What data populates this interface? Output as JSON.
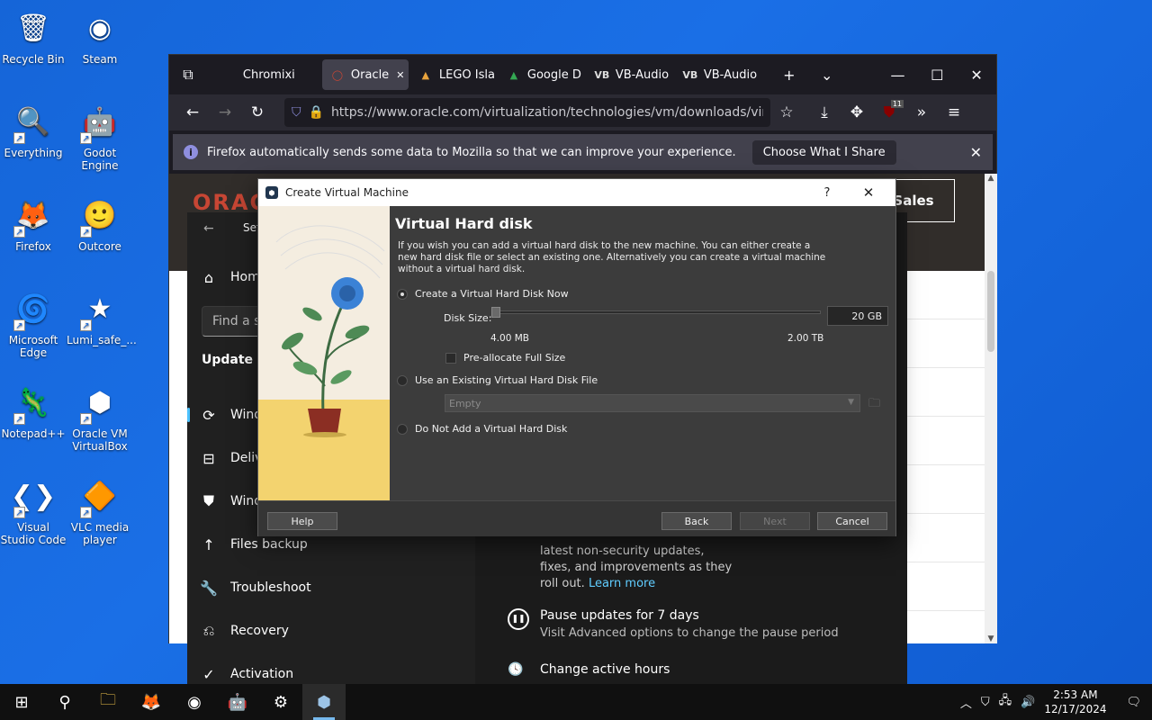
{
  "desktop": {
    "icons": [
      {
        "label": "Recycle Bin",
        "icon": "recycle-bin-icon",
        "glyph": "🗑"
      },
      {
        "label": "Steam",
        "icon": "steam-icon",
        "glyph": "◉"
      },
      {
        "label": "Everything",
        "icon": "everything-search-icon",
        "glyph": "🔍"
      },
      {
        "label": "Godot Engine",
        "icon": "godot-icon",
        "glyph": "🤖"
      },
      {
        "label": "Firefox",
        "icon": "firefox-icon",
        "glyph": "🦊"
      },
      {
        "label": "Outcore",
        "icon": "outcore-icon",
        "glyph": "🙂"
      },
      {
        "label": "Microsoft Edge",
        "icon": "edge-icon",
        "glyph": "🌀"
      },
      {
        "label": "Lumi_safe_...",
        "icon": "star-icon",
        "glyph": "★"
      },
      {
        "label": "Notepad++",
        "icon": "notepad-plus-plus-icon",
        "glyph": "🦎"
      },
      {
        "label": "Oracle VM VirtualBox",
        "icon": "virtualbox-icon",
        "glyph": "⬢"
      },
      {
        "label": "Visual Studio Code",
        "icon": "vscode-icon",
        "glyph": "❮❯"
      },
      {
        "label": "VLC media player",
        "icon": "vlc-icon",
        "glyph": "🔶"
      }
    ]
  },
  "firefox": {
    "tabs": [
      {
        "label": "Chromixi",
        "fav": ""
      },
      {
        "label": "Oracle",
        "fav": "◯"
      },
      {
        "label": "LEGO Isla",
        "fav": "▲"
      },
      {
        "label": "Google D",
        "fav": "▲"
      },
      {
        "label": "VB-Audio",
        "fav": "VB"
      },
      {
        "label": "VB-Audio",
        "fav": "VB"
      }
    ],
    "url": "https://www.oracle.com/virtualization/technologies/vm/downloads/virtualbox",
    "extension_badge": "11",
    "notice": {
      "text": "Firefox automatically sends some data to Mozilla so that we can improve your experience.",
      "button": "Choose What I Share"
    },
    "page": {
      "logo": "ORACLE",
      "sales_button": "t Sales"
    }
  },
  "settings": {
    "title": "Set",
    "nav": {
      "home": "Home",
      "search_placeholder": "Find a se",
      "section": "Update &",
      "items": [
        "Wind",
        "Deliv",
        "Wind",
        "Files backup",
        "Troubleshoot",
        "Recovery",
        "Activation"
      ]
    },
    "main": {
      "partial_text": "latest non-security updates, fixes, and improvements as they roll out.",
      "learn_more": "Learn more",
      "pause_title": "Pause updates for 7 days",
      "pause_sub": "Visit Advanced options to change the pause period",
      "active_hours": "Change active hours"
    }
  },
  "vbox": {
    "title": "Create Virtual Machine",
    "help_symbol": "?",
    "heading": "Virtual Hard disk",
    "description": "If you wish you can add a virtual hard disk to the new machine. You can either create a new hard disk file or select an existing one. Alternatively you can create a virtual machine without a virtual hard disk.",
    "option_create": "Create a Virtual Hard Disk Now",
    "disk_size_label": "Disk Size:",
    "disk_size_value": "20 GB",
    "min_size": "4.00 MB",
    "max_size": "2.00 TB",
    "preallocate": "Pre-allocate Full Size",
    "option_existing": "Use an Existing Virtual Hard Disk File",
    "existing_placeholder": "Empty",
    "option_none": "Do Not Add a Virtual Hard Disk",
    "buttons": {
      "help": "Help",
      "back": "Back",
      "next": "Next",
      "cancel": "Cancel"
    }
  },
  "taskbar": {
    "time": "2:53 AM",
    "date": "12/17/2024"
  }
}
